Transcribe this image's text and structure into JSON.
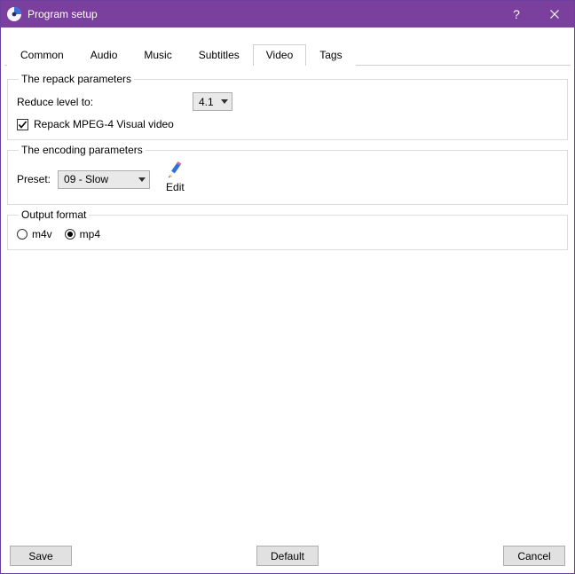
{
  "window": {
    "title": "Program setup",
    "help_symbol": "?",
    "close_label": "Close"
  },
  "tabs": [
    {
      "label": "Common"
    },
    {
      "label": "Audio"
    },
    {
      "label": "Music"
    },
    {
      "label": "Subtitles"
    },
    {
      "label": "Video",
      "active": true
    },
    {
      "label": "Tags"
    }
  ],
  "repack": {
    "legend": "The repack parameters",
    "reduce_label": "Reduce level to:",
    "reduce_value": "4.1",
    "repack_mpeg4_label": "Repack MPEG-4 Visual video",
    "repack_mpeg4_checked": true
  },
  "encoding": {
    "legend": "The encoding parameters",
    "preset_label": "Preset:",
    "preset_value": "09 - Slow",
    "edit_label": "Edit"
  },
  "output": {
    "legend": "Output format",
    "options": [
      {
        "label": "m4v",
        "selected": false
      },
      {
        "label": "mp4",
        "selected": true
      }
    ]
  },
  "buttons": {
    "save": "Save",
    "default": "Default",
    "cancel": "Cancel"
  }
}
